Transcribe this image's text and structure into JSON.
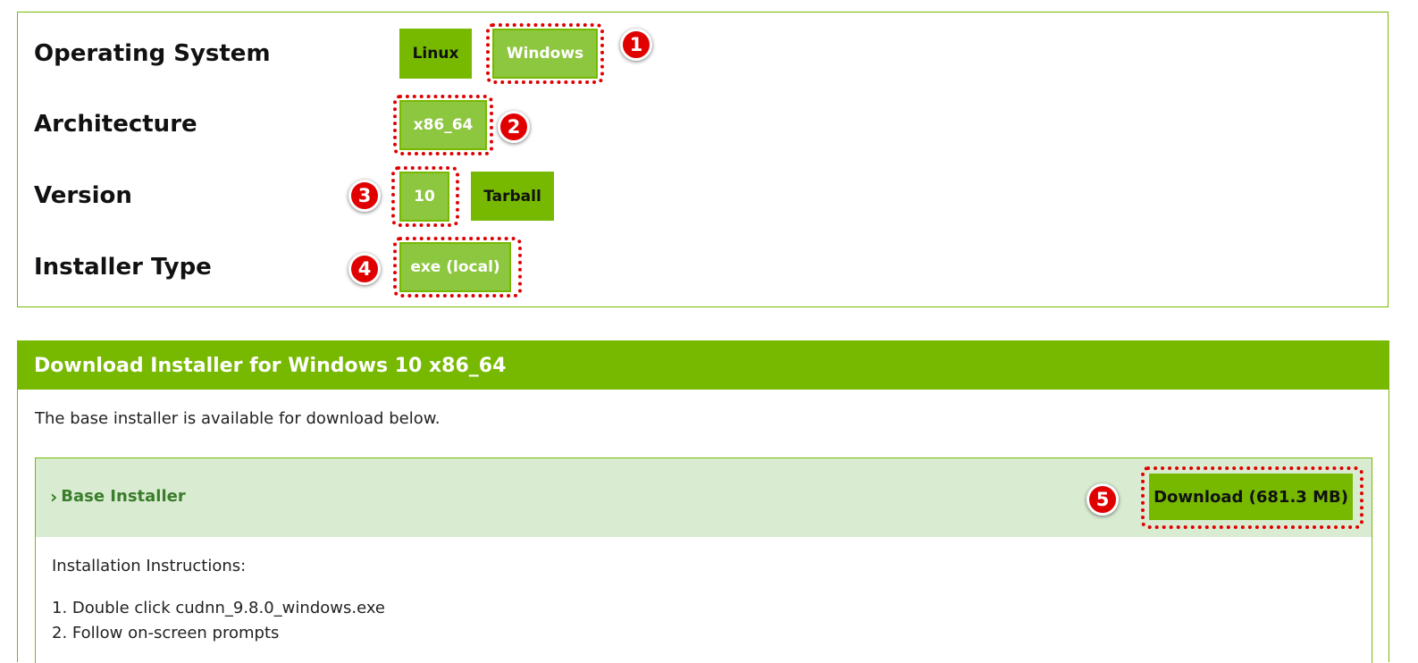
{
  "selectors": {
    "os": {
      "label": "Operating System",
      "options": [
        "Linux",
        "Windows"
      ],
      "selected": "Windows"
    },
    "arch": {
      "label": "Architecture",
      "options": [
        "x86_64"
      ],
      "selected": "x86_64"
    },
    "version": {
      "label": "Version",
      "options": [
        "10",
        "Tarball"
      ],
      "selected": "10"
    },
    "installer_type": {
      "label": "Installer Type",
      "options": [
        "exe (local)"
      ],
      "selected": "exe (local)"
    }
  },
  "markers": [
    "1",
    "2",
    "3",
    "4",
    "5"
  ],
  "download": {
    "header": "Download Installer for Windows 10 x86_64",
    "description": "The base installer is available for download below.",
    "base_installer": {
      "toggle_label": "Base Installer",
      "button_label": "Download (681.3 MB)",
      "instructions_title": "Installation Instructions:",
      "steps": [
        "1. Double click cudnn_9.8.0_windows.exe",
        "2. Follow on-screen prompts"
      ]
    }
  },
  "colors": {
    "accent": "#76b900",
    "selected": "#8dc63f",
    "highlight": "#e00000",
    "installer_bar": "#d9ecd2"
  },
  "icons": {
    "chevron": "chevron-right-icon"
  }
}
